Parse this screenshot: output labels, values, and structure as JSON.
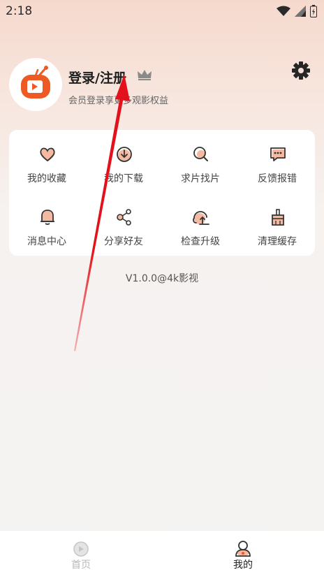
{
  "status": {
    "time": "2:18"
  },
  "header": {
    "title": "登录/注册",
    "subtitle": "会员登录享更多观影权益"
  },
  "grid": [
    {
      "label": "我的收藏",
      "icon": "heart-icon"
    },
    {
      "label": "我的下载",
      "icon": "download-icon"
    },
    {
      "label": "求片找片",
      "icon": "search-icon"
    },
    {
      "label": "反馈报错",
      "icon": "feedback-icon"
    },
    {
      "label": "消息中心",
      "icon": "bell-icon"
    },
    {
      "label": "分享好友",
      "icon": "share-icon"
    },
    {
      "label": "检查升级",
      "icon": "upgrade-icon"
    },
    {
      "label": "清理缓存",
      "icon": "broom-icon"
    }
  ],
  "version": "V1.0.0@4k影视",
  "nav": {
    "home": "首页",
    "mine": "我的"
  },
  "colors": {
    "accent": "#ee5a24",
    "icon_fill": "#f4b9a0",
    "arrow": "#e3111b"
  }
}
